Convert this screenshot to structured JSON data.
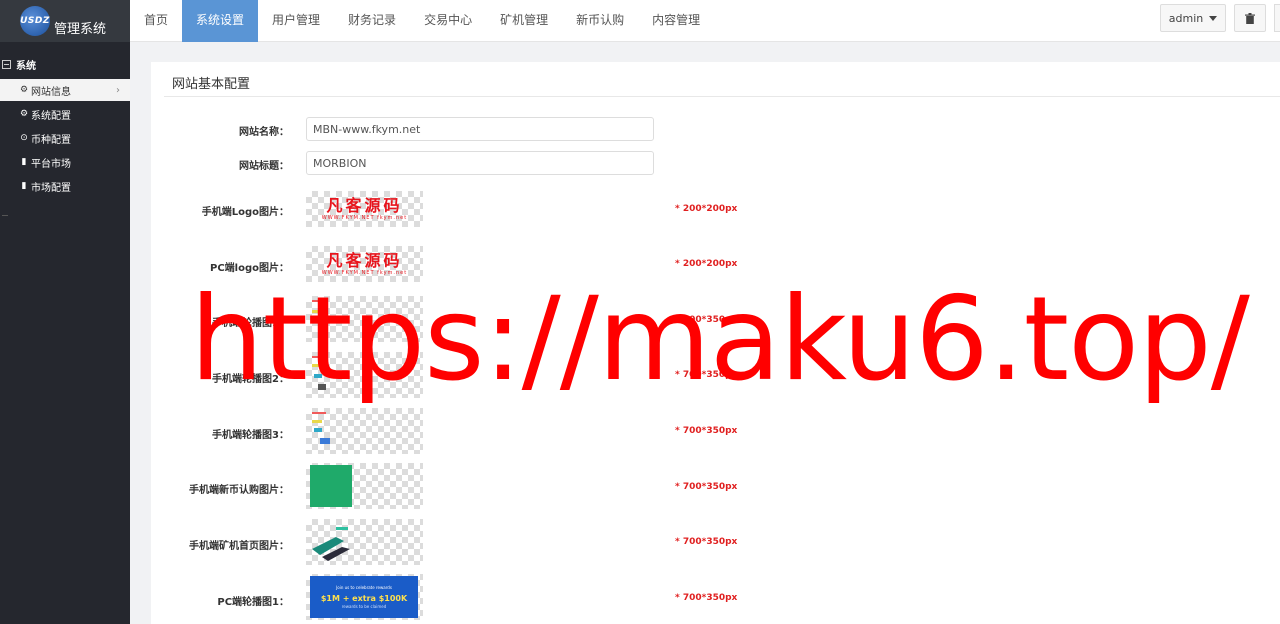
{
  "logo": {
    "mark": "USDZ",
    "title": "管理系统"
  },
  "nav": [
    {
      "label": "首页"
    },
    {
      "label": "系统设置",
      "active": true
    },
    {
      "label": "用户管理"
    },
    {
      "label": "财务记录"
    },
    {
      "label": "交易中心"
    },
    {
      "label": "矿机管理"
    },
    {
      "label": "新币认购"
    },
    {
      "label": "内容管理"
    }
  ],
  "user": {
    "label": "admin"
  },
  "sidebar": {
    "section": "系统",
    "items": [
      {
        "label": "网站信息",
        "icon": "gear-icon",
        "active": true
      },
      {
        "label": "系统配置",
        "icon": "gear-icon"
      },
      {
        "label": "币种配置",
        "icon": "circle-dot-icon"
      },
      {
        "label": "平台市场",
        "icon": "bar-chart-icon"
      },
      {
        "label": "市场配置",
        "icon": "bar-chart-icon"
      }
    ]
  },
  "panel": {
    "title": "网站基本配置",
    "site_name": {
      "label": "网站名称：",
      "value": "MBN-www.fkym.net"
    },
    "site_title": {
      "label": "网站标题：",
      "value": "MORBION"
    },
    "images": [
      {
        "label": "手机端Logo图片：",
        "hint": "* 200*200px"
      },
      {
        "label": "PC端logo图片：",
        "hint": "* 200*200px"
      },
      {
        "label": "手机端轮播图1：",
        "hint": "* 700*350px"
      },
      {
        "label": "手机端轮播图2：",
        "hint": "* 700*350px"
      },
      {
        "label": "手机端轮播图3：",
        "hint": "* 700*350px"
      },
      {
        "label": "手机端新币认购图片：",
        "hint": "* 700*350px"
      },
      {
        "label": "手机端矿机首页图片：",
        "hint": "* 700*350px"
      },
      {
        "label": "PC端轮播图1：",
        "hint": "* 700*350px"
      }
    ],
    "logo_image": {
      "main": "凡客源码",
      "sub": "WWW.FKYM.NET    fkym.net"
    },
    "banner": {
      "line1": "Join us to celebrate rewards",
      "line2": "$1M + extra $100K",
      "line3": "rewards to be claimed"
    }
  },
  "watermark": "https://maku6.top/"
}
